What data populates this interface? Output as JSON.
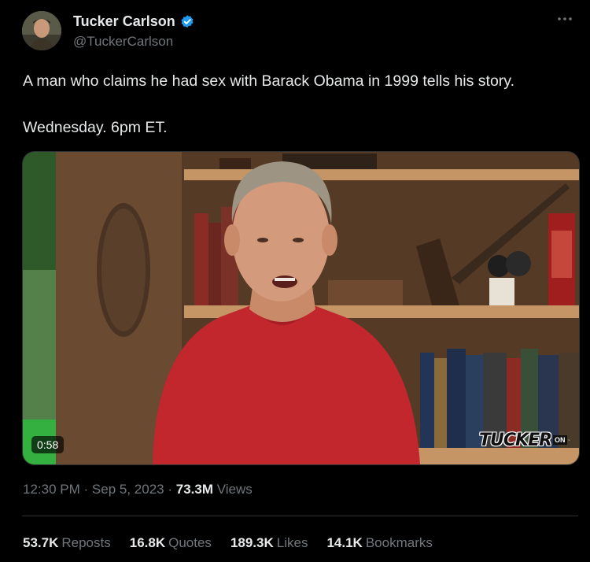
{
  "author": {
    "name": "Tucker Carlson",
    "handle": "@TuckerCarlson",
    "verified": true,
    "verified_color": "#1d9bf0"
  },
  "tweet": {
    "text_line1": "A man who claims he had sex with Barack Obama in 1999 tells his story.",
    "text_line2": "Wednesday. 6pm ET."
  },
  "media": {
    "duration": "0:58",
    "brand_word": "TUCKER",
    "brand_on": "ON"
  },
  "meta": {
    "time": "12:30 PM",
    "separator": "·",
    "date": "Sep 5, 2023",
    "views_count": "73.3M",
    "views_label": "Views"
  },
  "stats": [
    {
      "count": "53.7K",
      "label": "Reposts"
    },
    {
      "count": "16.8K",
      "label": "Quotes"
    },
    {
      "count": "189.3K",
      "label": "Likes"
    },
    {
      "count": "14.1K",
      "label": "Bookmarks"
    }
  ],
  "icons": {
    "more": "more-icon",
    "verified": "verified-badge-icon",
    "x_logo": "x-logo-icon"
  }
}
